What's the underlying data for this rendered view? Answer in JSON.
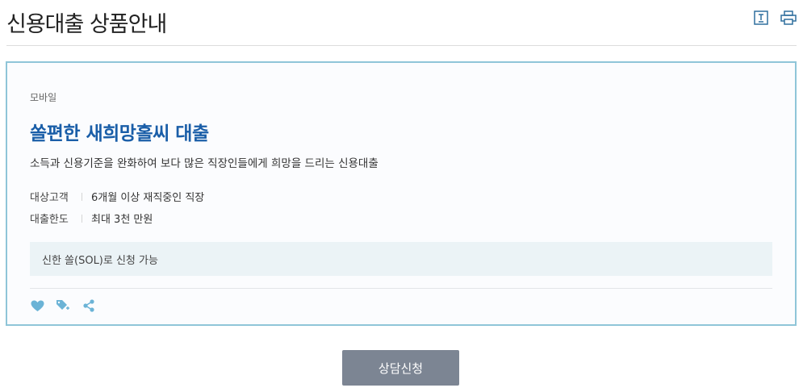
{
  "page": {
    "title": "신용대출 상품안내",
    "tools": [
      "text-size-icon",
      "print-icon"
    ]
  },
  "product": {
    "category": "모바일",
    "name": "쏠편한 새희망홀씨 대출",
    "description": "소득과 신용기준을 완화하여 보다 많은 직장인들에게 희망을 드리는 신용대출",
    "info": [
      {
        "label": "대상고객",
        "value": "6개월 이상 재직중인 직장"
      },
      {
        "label": "대출한도",
        "value": "최대 3천 만원"
      }
    ],
    "notice": "신한 쏠(SOL)로 신청 가능",
    "actions": [
      "heart-icon",
      "tag-add-icon",
      "share-icon"
    ]
  },
  "consult_button_label": "상담신청",
  "colors": {
    "accent_blue": "#1a5ea8",
    "card_border": "#8fc5d8",
    "icon_blue": "#6bb3d6",
    "button_gray": "#7c8593"
  }
}
